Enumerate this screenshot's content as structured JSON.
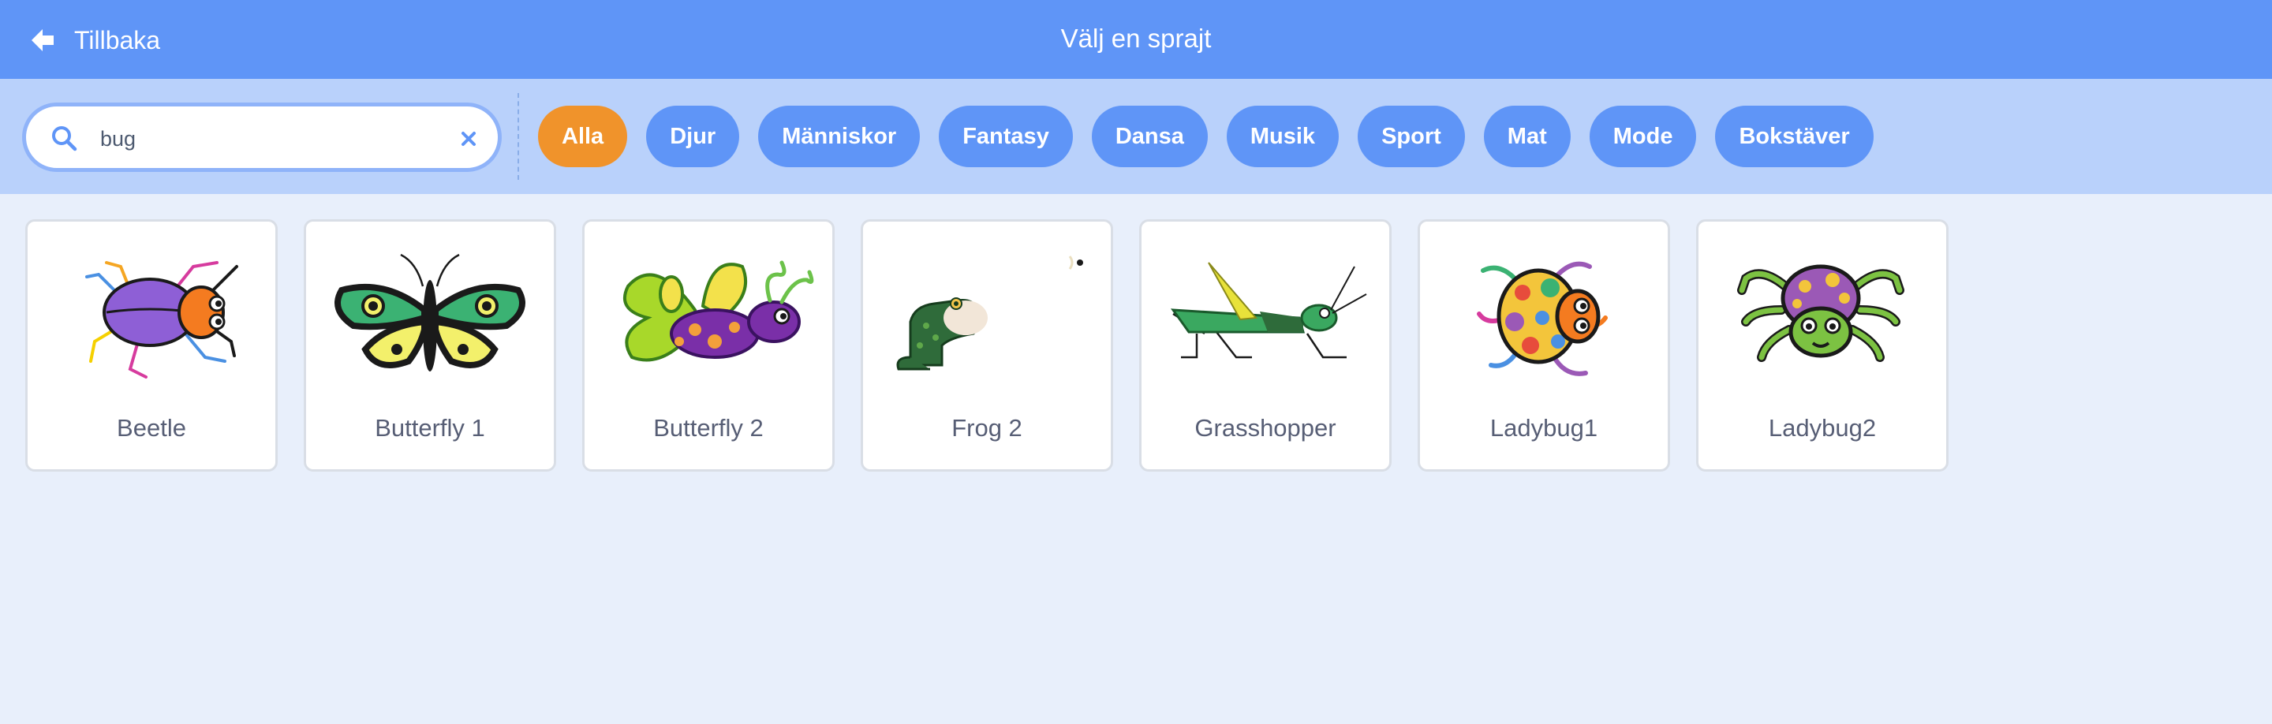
{
  "header": {
    "back_label": "Tillbaka",
    "title": "Välj en sprajt"
  },
  "search": {
    "value": "bug",
    "placeholder": ""
  },
  "categories": [
    "Alla",
    "Djur",
    "Människor",
    "Fantasy",
    "Dansa",
    "Musik",
    "Sport",
    "Mat",
    "Mode",
    "Bokstäver"
  ],
  "selected_category": "Alla",
  "sprites": [
    {
      "name": "Beetle",
      "icon": "beetle-icon"
    },
    {
      "name": "Butterfly 1",
      "icon": "butterfly-icon"
    },
    {
      "name": "Butterfly 2",
      "icon": "butterfly-icon"
    },
    {
      "name": "Frog 2",
      "icon": "frog-icon"
    },
    {
      "name": "Grasshopper",
      "icon": "grasshopper-icon"
    },
    {
      "name": "Ladybug1",
      "icon": "ladybug-icon"
    },
    {
      "name": "Ladybug2",
      "icon": "ladybug-icon"
    }
  ],
  "colors": {
    "header": "#5f95f7",
    "filter_bar": "#b9d1fb",
    "background": "#e8effb",
    "chip": "#5f95f7",
    "chip_active": "#f0932b"
  }
}
